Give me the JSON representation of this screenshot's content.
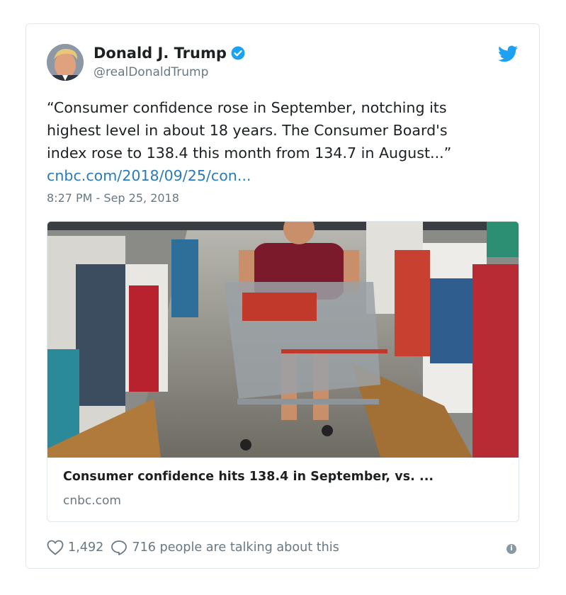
{
  "tweet": {
    "author_name": "Donald J. Trump",
    "author_handle": "@realDonaldTrump",
    "text_lines": [
      "“Consumer confidence rose in September, notching its",
      "highest level in about 18 years. The Consumer Board's",
      "index rose to 138.4 this month from 134.7 in August...”"
    ],
    "link_text": "cnbc.com/2018/09/25/con...",
    "timestamp": "8:27 PM - Sep 25, 2018"
  },
  "link_card": {
    "title": "Consumer confidence hits 138.4 in September, vs. ...",
    "domain": "cnbc.com"
  },
  "footer": {
    "likes": "1,492",
    "replies_text": "716 people are talking about this",
    "info_glyph": "i"
  },
  "icons": {
    "verified": "verified-badge-icon",
    "bird": "twitter-bird-icon",
    "heart": "heart-icon",
    "reply": "speech-bubble-icon",
    "info": "info-icon"
  },
  "colors": {
    "link": "#2b7bb9",
    "twitter_blue": "#1da1f2",
    "muted": "#697882",
    "border": "#e1e8ed"
  }
}
